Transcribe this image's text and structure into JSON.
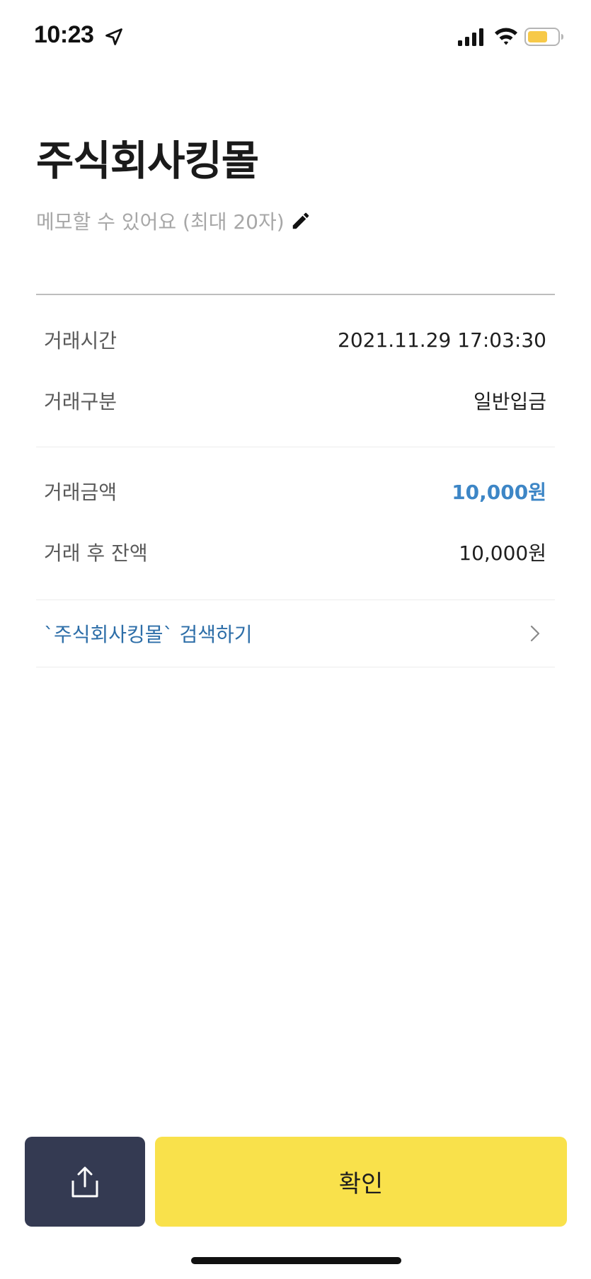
{
  "status_bar": {
    "time": "10:23",
    "icons": [
      "location-arrow-icon",
      "cellular-signal-icon",
      "wifi-icon",
      "battery-icon"
    ],
    "battery_color": "#f7c948"
  },
  "header": {
    "title": "주식회사킹몰",
    "memo_placeholder": "메모할 수 있어요 (최대 20자)",
    "memo_icon": "pencil-icon"
  },
  "details": [
    {
      "label": "거래시간",
      "value": "2021.11.29 17:03:30"
    },
    {
      "label": "거래구분",
      "value": "일반입금"
    },
    {
      "label": "거래금액",
      "value": "10,000원"
    },
    {
      "label": "거래 후 잔액",
      "value": "10,000원"
    }
  ],
  "search_link": {
    "text": "`주식회사킹몰` 검색하기",
    "icon": "chevron-right-icon"
  },
  "footer": {
    "share_icon": "share-icon",
    "confirm_label": "확인"
  },
  "colors": {
    "accent_amount": "#3d86c6",
    "link": "#2d6ea8",
    "share_button_bg": "#343a52",
    "confirm_button_bg": "#f9e14b"
  }
}
